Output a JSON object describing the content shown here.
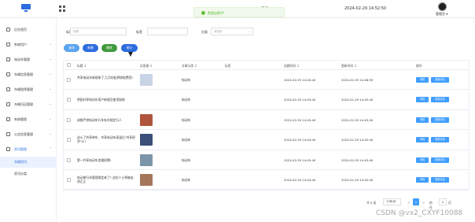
{
  "topbar": {
    "text": "系统",
    "datetime": "2024-02-29 14:52:50",
    "user_label": "管理员 ▾"
  },
  "toast": {
    "message": "数据加载中!"
  },
  "sidebar": {
    "items": [
      {
        "label": "后台首页",
        "chevron": ""
      },
      {
        "label": "系统用户",
        "chevron": "⌄"
      },
      {
        "label": "电动车管理",
        "chevron": "⌄"
      },
      {
        "label": "车辆信息管理",
        "chevron": "⌄"
      },
      {
        "label": "车辆租赁管理",
        "chevron": "⌄"
      },
      {
        "label": "车辆归还管理",
        "chevron": "⌄"
      },
      {
        "label": "系统管理",
        "chevron": "⌄"
      },
      {
        "label": "公告信息管理",
        "chevron": "⌄"
      },
      {
        "label": "资讯管理",
        "chevron": "⌃"
      }
    ],
    "subitems": [
      {
        "label": "车辆资讯"
      },
      {
        "label": "资讯分类"
      }
    ]
  },
  "filters": {
    "title_label": "标题",
    "title_placeholder": "标题",
    "tag_label": "标签",
    "category_label": "分类",
    "category_placeholder": "请选择",
    "select_arrow": "⌄"
  },
  "buttons": {
    "search": "查询",
    "add": "新增",
    "delete": "删除",
    "stat": "统计"
  },
  "table": {
    "headers": {
      "title": "标题 ⇕",
      "image": "封面图 ⇕",
      "category": "文章分类 ⇕",
      "tag": "标签",
      "create_time": "创建时间 ⇕",
      "update_time": "更新时间 ⇕",
      "action": "操作"
    },
    "rows": [
      {
        "title": "共享电动车新规来了,九月份起将收取费用!",
        "category": "电动车",
        "tag": "",
        "create_time": "2024-02-29 14:45:40",
        "update_time": "2024-02-29 14:48:59",
        "op1": "详情",
        "op2": "查看评论"
      },
      {
        "title": "明园共享电动车用户新规及使用指南",
        "category": "电动车",
        "tag": "",
        "create_time": "2024-02-29 14:45:40",
        "update_time": "2024-02-29 14:45:40",
        "op1": "详情",
        "op2": "查看评论"
      },
      {
        "title": "成都严禁电动车行车有关规定行人",
        "category": "电动车",
        "tag": "",
        "create_time": "2024-02-29 14:45:40",
        "update_time": "2024-02-29 14:45:40",
        "op1": "详情",
        "op2": "查看评论"
      },
      {
        "title": "这么了共享单车、共享电动车高温后\"共享经济\"么?",
        "category": "电动车",
        "tag": "",
        "create_time": "2024-02-29 14:45:40",
        "update_time": "2024-02-29 14:45:40",
        "op1": "详情",
        "op2": "查看评论"
      },
      {
        "title": "第一共享电动车违规招聘!",
        "category": "电动车",
        "tag": "",
        "create_time": "2024-02-29 14:45:40",
        "update_time": "2024-02-29 14:45:40",
        "op1": "详情",
        "op2": "查看评论"
      },
      {
        "title": "电动单行车管理规定来了? 这些人士将被迫改正正",
        "category": "电动车",
        "tag": "",
        "create_time": "2024-02-29 14:45:40",
        "update_time": "2024-02-29 14:45:40",
        "op1": "详情",
        "op2": "查看评论"
      }
    ],
    "thumb_colors": [
      "#c9d3e6",
      "#6d8fb5",
      "#b0553d",
      "#3b4f78",
      "#7c95a8",
      "#a4765a"
    ]
  },
  "pagination": {
    "total": "共 6 条",
    "page_size": "10条/页",
    "prev": "<",
    "current": "1",
    "next": ">",
    "goto": "前往",
    "goto_value": "1",
    "page_suffix": "页"
  },
  "watermark": "CSDN @vx2_CXYF10088"
}
